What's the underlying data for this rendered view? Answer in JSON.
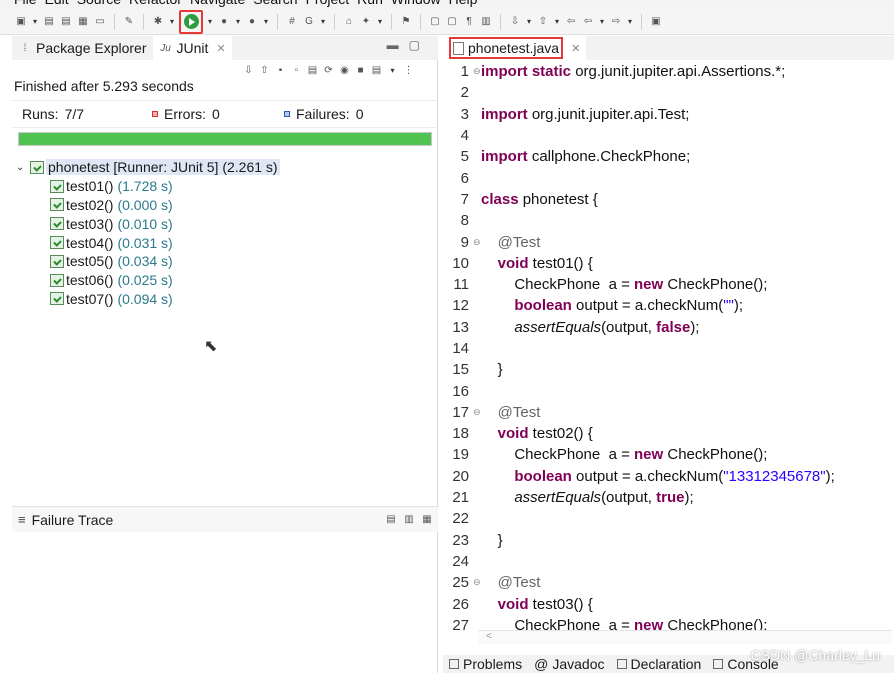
{
  "menu": [
    "File",
    "Edit",
    "Source",
    "Refactor",
    "Navigate",
    "Search",
    "Project",
    "Run",
    "Window",
    "Help"
  ],
  "left_tabs": {
    "package_explorer": "Package Explorer",
    "junit": "JUnit"
  },
  "junit": {
    "status": "Finished after 5.293 seconds",
    "runs_label": "Runs:",
    "runs_value": "7/7",
    "errors_label": "Errors:",
    "errors_value": "0",
    "failures_label": "Failures:",
    "failures_value": "0",
    "progress_fraction": 1.0,
    "progress_color": "#4fc451",
    "root": {
      "name": "phonetest [Runner: JUnit 5]",
      "time": "(2.261 s)"
    },
    "tests": [
      {
        "name": "test01()",
        "time": "(1.728 s)"
      },
      {
        "name": "test02()",
        "time": "(0.000 s)"
      },
      {
        "name": "test03()",
        "time": "(0.010 s)"
      },
      {
        "name": "test04()",
        "time": "(0.031 s)"
      },
      {
        "name": "test05()",
        "time": "(0.034 s)"
      },
      {
        "name": "test06()",
        "time": "(0.025 s)"
      },
      {
        "name": "test07()",
        "time": "(0.094 s)"
      }
    ],
    "failure_trace": "Failure Trace"
  },
  "editor": {
    "tab_file": "phonetest.java"
  },
  "bottom_tabs": {
    "problems": "Problems",
    "javadoc": "Javadoc",
    "declaration": "Declaration",
    "console": "Console"
  },
  "watermark": "CSDN @Charley_Lu",
  "colors": {
    "highlight_border": "#e53935",
    "keyword": "#7f0055",
    "string": "#2a00ff"
  }
}
